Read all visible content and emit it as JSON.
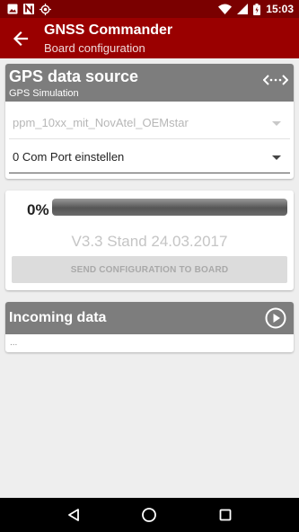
{
  "status_bar": {
    "time": "15:03",
    "left_icons": [
      "image-icon",
      "n-notification-icon",
      "gps-target-icon"
    ],
    "right_icons": [
      "wifi-icon",
      "signal-icon",
      "battery-icon"
    ]
  },
  "app_bar": {
    "title": "GNSS Commander",
    "subtitle": "Board configuration",
    "back_icon": "arrow-left-icon",
    "color": "#9a0000"
  },
  "gps_source": {
    "title": "GPS data source",
    "subtitle": "GPS Simulation",
    "swap_icon": "swap-horizontal-icon",
    "file_select": {
      "value": "ppm_10xx_mit_NovAtel_OEMstar",
      "enabled": false
    },
    "port_select": {
      "value": "0 Com Port einstellen",
      "enabled": true
    }
  },
  "progress": {
    "percent_label": "0%",
    "value": 0,
    "version": "V3.3 Stand 24.03.2017",
    "send_label": "SEND CONFIGURATION TO BOARD",
    "send_enabled": false
  },
  "incoming": {
    "title": "Incoming data",
    "play_icon": "play-circle-icon",
    "text": "..."
  },
  "nav_bar": {
    "icons": [
      "back-triangle-icon",
      "home-circle-icon",
      "recents-square-icon"
    ]
  }
}
